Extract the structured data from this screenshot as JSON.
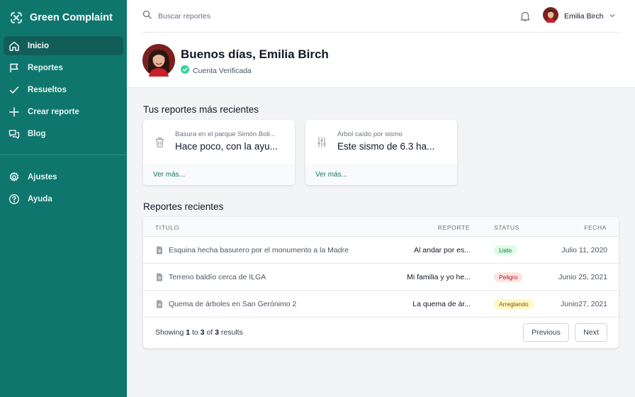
{
  "brand": {
    "name": "Green Complaint",
    "accent": "#0f766e"
  },
  "sidebar": {
    "items": [
      {
        "label": "Inicio",
        "icon": "home-icon",
        "active": true
      },
      {
        "label": "Reportes",
        "icon": "flag-icon"
      },
      {
        "label": "Resueltos",
        "icon": "check-icon"
      },
      {
        "label": "Crear reporte",
        "icon": "plus-icon"
      },
      {
        "label": "Blog",
        "icon": "chat-icon"
      }
    ],
    "secondary": [
      {
        "label": "Ajustes",
        "icon": "gear-icon"
      },
      {
        "label": "Ayuda",
        "icon": "help-icon"
      }
    ]
  },
  "topbar": {
    "search_placeholder": "Buscar reportes",
    "user_name": "Emilia Birch"
  },
  "header": {
    "greeting": "Buenos días, Emilia Birch",
    "verified": "Cuenta Verificada"
  },
  "recent": {
    "title": "Tus reportes más recientes",
    "cards": [
      {
        "title": "Basura en el parque Simón Boli...",
        "text": "Hace poco, con la ayu...",
        "link": "Ver más...",
        "icon": "trash-icon"
      },
      {
        "title": "Árbol caído por sismo",
        "text": "Este sismo de 6.3 ha...",
        "link": "Ver más...",
        "icon": "sliders-icon"
      }
    ]
  },
  "table": {
    "title": "Reportes recientes",
    "headers": {
      "title": "TITULO",
      "report": "REPORTE",
      "status": "STATUS",
      "date": "FECHA"
    },
    "rows": [
      {
        "title": "Esquina hecha basurero por el monumento a la Madre",
        "report": "Al andar por es...",
        "status": "Listo",
        "date": "Julio 11, 2020",
        "status_bg": "#dcfce7",
        "status_fg": "#166534"
      },
      {
        "title": "Terreno baldío cerca de ILGA",
        "report": "Mi familia y yo he...",
        "status": "Peligro",
        "date": "Junio 25, 2021",
        "status_bg": "#fee2e2",
        "status_fg": "#991b1b"
      },
      {
        "title": "Quema de árboles en San Gerónimo 2",
        "report": "La quema de ár...",
        "status": "Arreglando",
        "date": "Junio27, 2021",
        "status_bg": "#fef9c3",
        "status_fg": "#854d0e"
      }
    ],
    "footer": {
      "prefix": "Showing",
      "from": "1",
      "to_word": "to",
      "to": "3",
      "of_word": "of",
      "total": "3",
      "suffix": "results"
    },
    "previous": "Previous",
    "next": "Next"
  }
}
